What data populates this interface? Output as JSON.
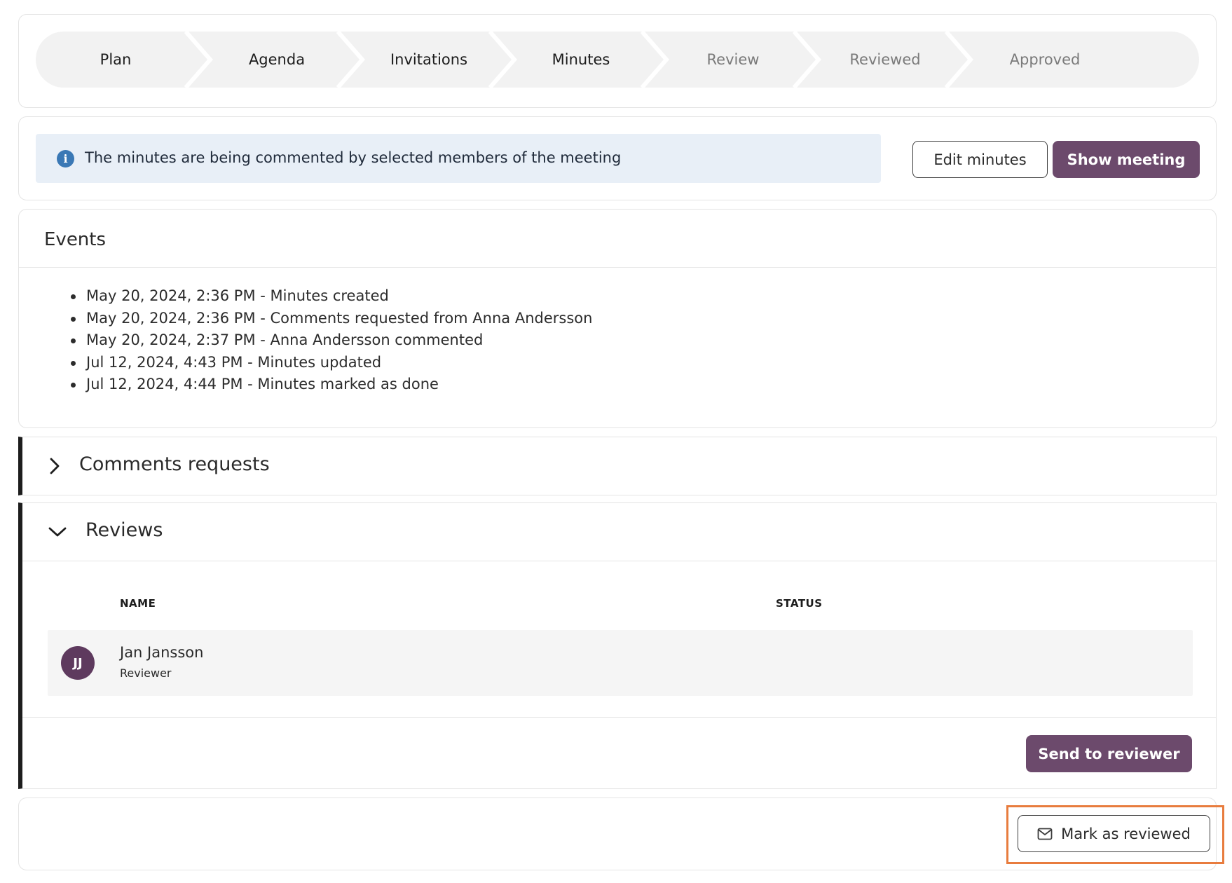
{
  "stepper": {
    "steps": [
      {
        "label": "Plan",
        "state": "done"
      },
      {
        "label": "Agenda",
        "state": "done"
      },
      {
        "label": "Invitations",
        "state": "done"
      },
      {
        "label": "Minutes",
        "state": "current"
      },
      {
        "label": "Review",
        "state": "upcoming"
      },
      {
        "label": "Reviewed",
        "state": "upcoming"
      },
      {
        "label": "Approved",
        "state": "upcoming"
      }
    ]
  },
  "info": {
    "message": "The minutes are being commented by selected members of the meeting",
    "icon": "info-icon"
  },
  "actions": {
    "edit_minutes": "Edit minutes",
    "show_meeting": "Show meeting"
  },
  "events": {
    "title": "Events",
    "items": [
      "May 20, 2024, 2:36 PM - Minutes created",
      "May 20, 2024, 2:36 PM - Comments requested from Anna Andersson",
      "May 20, 2024, 2:37 PM - Anna Andersson commented",
      "Jul 12, 2024, 4:43 PM - Minutes updated",
      "Jul 12, 2024, 4:44 PM - Minutes marked as done"
    ]
  },
  "comments_requests": {
    "title": "Comments requests",
    "expanded": false
  },
  "reviews": {
    "title": "Reviews",
    "expanded": true,
    "columns": {
      "name": "NAME",
      "status": "STATUS"
    },
    "rows": [
      {
        "initials": "JJ",
        "name": "Jan Jansson",
        "role": "Reviewer",
        "status": ""
      }
    ],
    "send_button": "Send to reviewer"
  },
  "footer": {
    "mark_reviewed": "Mark as reviewed"
  },
  "colors": {
    "primary": "#6c4a6c",
    "avatar": "#5e3a5e",
    "info_bg": "#e8eff7",
    "info_icon": "#3a78b5",
    "focus": "#e87c3e"
  }
}
